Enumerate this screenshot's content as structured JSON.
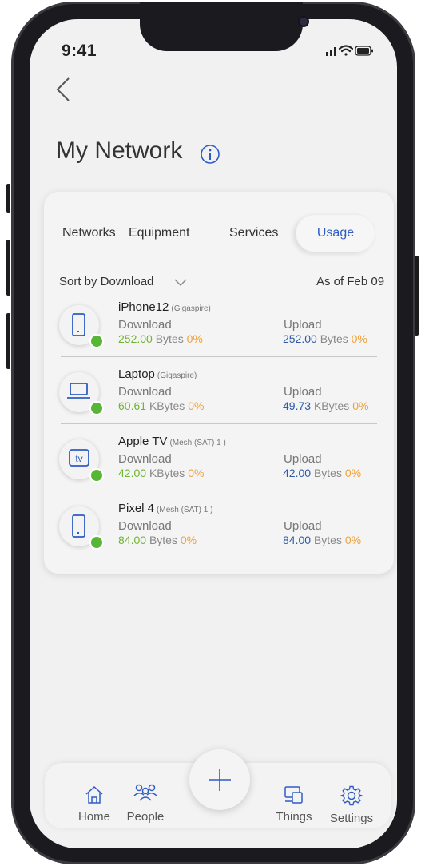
{
  "status_bar": {
    "time": "9:41"
  },
  "header": {
    "title": "My Network"
  },
  "tabs": [
    "Networks",
    "Equipment",
    "Services",
    "Usage"
  ],
  "active_tab": "Usage",
  "sort": {
    "label": "Sort by Download",
    "as_of": "As of Feb 09"
  },
  "labels": {
    "download": "Download",
    "upload": "Upload"
  },
  "devices": [
    {
      "name": "iPhone12",
      "source": "(Gigaspire)",
      "icon": "phone-icon",
      "download_value": "252.00",
      "download_unit": "Bytes",
      "download_pct": "0%",
      "upload_value": "252.00",
      "upload_unit": "Bytes",
      "upload_pct": "0%"
    },
    {
      "name": "Laptop",
      "source": "(Gigaspire)",
      "icon": "laptop-icon",
      "download_value": "60.61",
      "download_unit": "KBytes",
      "download_pct": "0%",
      "upload_value": "49.73",
      "upload_unit": "KBytes",
      "upload_pct": "0%"
    },
    {
      "name": "Apple TV",
      "source": "(Mesh (SAT) 1 )",
      "icon": "tv-icon",
      "download_value": "42.00",
      "download_unit": "KBytes",
      "download_pct": "0%",
      "upload_value": "42.00",
      "upload_unit": "Bytes",
      "upload_pct": "0%"
    },
    {
      "name": "Pixel 4",
      "source": "(Mesh (SAT) 1 )",
      "icon": "phone-icon",
      "download_value": "84.00",
      "download_unit": "Bytes",
      "download_pct": "0%",
      "upload_value": "84.00",
      "upload_unit": "Bytes",
      "upload_pct": "0%"
    }
  ],
  "tv_glyph": "tv",
  "bottom_nav": {
    "home": "Home",
    "people": "People",
    "things": "Things",
    "settings": "Settings"
  },
  "colors": {
    "accent": "#2f5cc4",
    "online": "#58b637",
    "download_value": "#6fb52f",
    "upload_value": "#2c5aa8",
    "percent": "#f0a23a"
  }
}
